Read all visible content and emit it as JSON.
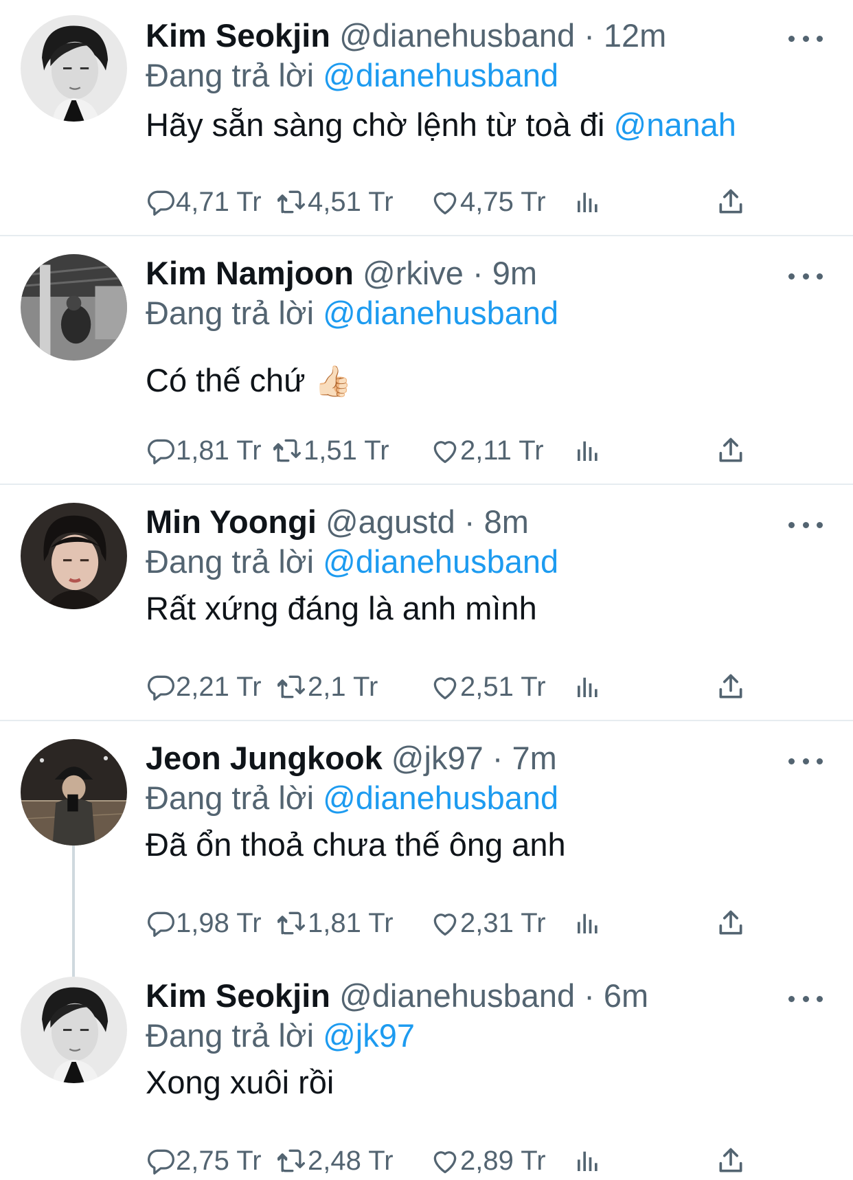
{
  "tweets": [
    {
      "name": "Kim Seokjin",
      "handle": "@dianehusband",
      "time": "12m",
      "replying_label": "Đang trả lời",
      "replying_to": "@dianehusband",
      "text": "Hãy sẵn sàng chờ lệnh từ toà đi",
      "text_mention": "@nanah",
      "stats": {
        "replies": "4,71 Tr",
        "retweets": "4,51 Tr",
        "likes": "4,75 Tr"
      }
    },
    {
      "name": "Kim Namjoon",
      "handle": "@rkive",
      "time": "9m",
      "replying_label": "Đang trả lời",
      "replying_to": "@dianehusband",
      "text": "Có thế chứ",
      "emoji": "👍🏻",
      "stats": {
        "replies": "1,81 Tr",
        "retweets": "1,51 Tr",
        "likes": "2,11 Tr"
      }
    },
    {
      "name": "Min Yoongi",
      "handle": "@agustd",
      "time": "8m",
      "replying_label": "Đang trả lời",
      "replying_to": "@dianehusband",
      "text": "Rất xứng đáng là anh mình",
      "stats": {
        "replies": "2,21 Tr",
        "retweets": "2,1 Tr",
        "likes": "2,51 Tr"
      }
    },
    {
      "name": "Jeon Jungkook",
      "handle": "@jk97",
      "time": "7m",
      "replying_label": "Đang trả lời",
      "replying_to": "@dianehusband",
      "text": "Đã ổn thoả chưa thế ông anh",
      "stats": {
        "replies": "1,98 Tr",
        "retweets": "1,81 Tr",
        "likes": "2,31 Tr"
      }
    },
    {
      "name": "Kim Seokjin",
      "handle": "@dianehusband",
      "time": "6m",
      "replying_label": "Đang trả lời",
      "replying_to": "@jk97",
      "text": "Xong xuôi rồi",
      "stats": {
        "replies": "2,75 Tr",
        "retweets": "2,48 Tr",
        "likes": "2,89 Tr"
      }
    }
  ],
  "separator": "·",
  "icons": {
    "reply": "reply-icon",
    "retweet": "retweet-icon",
    "like": "heart-icon",
    "views": "analytics-icon",
    "share": "share-icon",
    "more": "more-options-icon"
  },
  "colors": {
    "link": "#1d9bf0",
    "secondary": "#536471",
    "text": "#0f1419",
    "divider": "#e6ecf0"
  }
}
